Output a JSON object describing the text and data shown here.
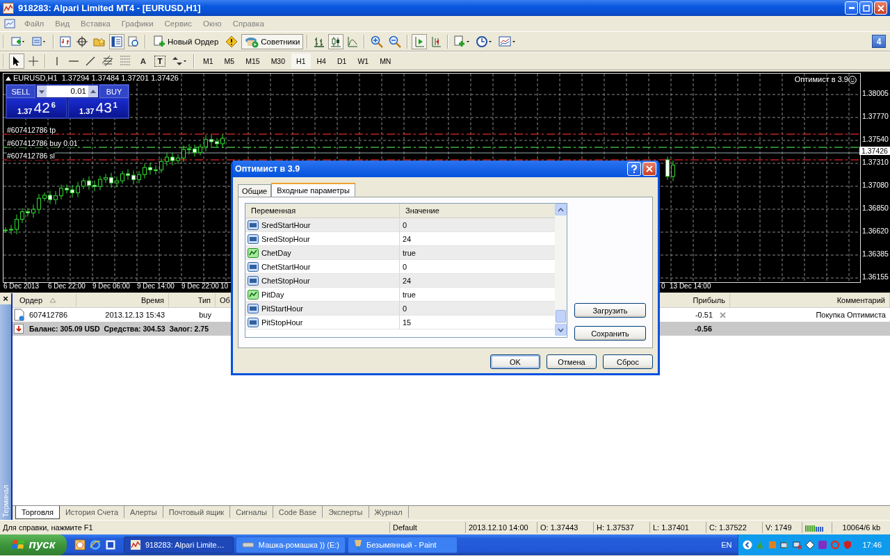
{
  "window": {
    "title": "918283: Alpari Limited MT4 - [EURUSD,H1]"
  },
  "menu": [
    "Файл",
    "Вид",
    "Вставка",
    "Графики",
    "Сервис",
    "Окно",
    "Справка"
  ],
  "toolbar": {
    "new_order": "Новый Ордер",
    "experts": {
      "label": "Советники",
      "on": true
    },
    "text_tool": "A",
    "label_tool": "T",
    "windows_count": "4",
    "timeframes": [
      {
        "label": "M1",
        "selected": false
      },
      {
        "label": "M5",
        "selected": false
      },
      {
        "label": "M15",
        "selected": false
      },
      {
        "label": "M30",
        "selected": false
      },
      {
        "label": "H1",
        "selected": true
      },
      {
        "label": "H4",
        "selected": false
      },
      {
        "label": "D1",
        "selected": false
      },
      {
        "label": "W1",
        "selected": false
      },
      {
        "label": "MN",
        "selected": false
      }
    ]
  },
  "chart": {
    "header": "EURUSD,H1  1.37294 1.37484 1.37201 1.37426",
    "expert": "Оптимист в 3.9",
    "trade_panel": {
      "sell": "SELL",
      "buy": "BUY",
      "lot": "0.01",
      "bid": {
        "big": "1.37",
        "pips": "42",
        "point": "6"
      },
      "ask": {
        "big": "1.37",
        "pips": "43",
        "point": "1"
      }
    },
    "order_lines": [
      {
        "label": "#607412786 tp",
        "kind": "tp"
      },
      {
        "label": "#607412786 buy 0.01",
        "kind": "open"
      },
      {
        "label": "#607412786 sl",
        "kind": "sl"
      }
    ],
    "price_labels": [
      "1.38005",
      "1.37770",
      "1.37540",
      "1.37310",
      "1.37080",
      "1.36850",
      "1.36620",
      "1.36385",
      "1.36155"
    ],
    "current_price": "1.37426",
    "time_labels": [
      "6 Dec 2013",
      "6 Dec 22:00",
      "9 Dec 06:00",
      "9 Dec 14:00",
      "9 Dec 22:00",
      "10",
      "0",
      "13 Dec 14:00"
    ]
  },
  "dialog": {
    "title": "Оптимист в 3.9",
    "tabs": [
      {
        "label": "Общие",
        "selected": false
      },
      {
        "label": "Входные параметры",
        "selected": true
      }
    ],
    "columns": [
      "Переменная",
      "Значение"
    ],
    "params": [
      {
        "name": "SredStartHour",
        "value": "0",
        "kind": "int"
      },
      {
        "name": "SredStopHour",
        "value": "24",
        "kind": "int"
      },
      {
        "name": "ChetDay",
        "value": "true",
        "kind": "bool"
      },
      {
        "name": "ChetStartHour",
        "value": "0",
        "kind": "int"
      },
      {
        "name": "ChetStopHour",
        "value": "24",
        "kind": "int"
      },
      {
        "name": "PitDay",
        "value": "true",
        "kind": "bool"
      },
      {
        "name": "PitStartHour",
        "value": "0",
        "kind": "int"
      },
      {
        "name": "PitStopHour",
        "value": "15",
        "kind": "int"
      }
    ],
    "side_buttons": [
      "Загрузить",
      "Сохранить"
    ],
    "buttons": [
      {
        "label": "OK",
        "default": true
      },
      {
        "label": "Отмена",
        "default": false
      },
      {
        "label": "Сброс",
        "default": false
      }
    ]
  },
  "terminal": {
    "side_label": "Терминал",
    "close": "×",
    "columns": [
      "Ордер",
      "Время",
      "Тип",
      "Об",
      "Прибыль",
      "Комментарий"
    ],
    "orders": [
      {
        "order": "607412786",
        "time": "2013.12.13 15:43",
        "type": "buy",
        "profit": "-0.51",
        "comment": "Покупка Оптимиста"
      }
    ],
    "balance": {
      "summary": "Баланс: 305.09 USD  Средства: 304.53  Залог: 2.75",
      "profit": "-0.56"
    },
    "tabs": [
      {
        "label": "Торговля",
        "selected": true
      },
      {
        "label": "История Счета",
        "selected": false
      },
      {
        "label": "Алерты",
        "selected": false
      },
      {
        "label": "Почтовый ящик",
        "selected": false
      },
      {
        "label": "Сигналы",
        "selected": false
      },
      {
        "label": "Code Base",
        "selected": false
      },
      {
        "label": "Эксперты",
        "selected": false
      },
      {
        "label": "Журнал",
        "selected": false
      }
    ]
  },
  "status_bar": {
    "help": "Для справки, нажмите F1",
    "profile": "Default",
    "time": "2013.12.10 14:00",
    "open": "O: 1.37443",
    "high": "H: 1.37537",
    "low": "L: 1.37401",
    "close": "C: 1.37522",
    "volume": "V: 1749",
    "traffic": "10064/6 kb"
  },
  "taskbar": {
    "start": "пуск",
    "tasks": [
      {
        "label": "918283: Alpari Limite…",
        "selected": true
      },
      {
        "label": "Машка-ромашка )) (E:)",
        "selected": false
      },
      {
        "label": "Безымянный - Paint",
        "selected": false
      }
    ],
    "language": "EN",
    "clock": "17:46"
  }
}
